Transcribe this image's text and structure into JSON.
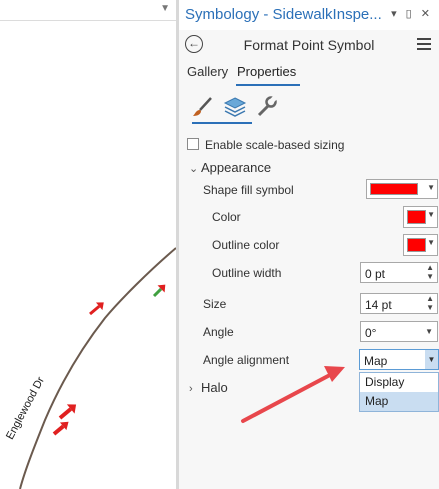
{
  "map": {
    "street_label": "Englewood Dr"
  },
  "pane": {
    "title": "Symbology - SidewalkInspe...",
    "window_controls": "▾ ▯ ✕",
    "page_title": "Format Point Symbol",
    "tabs": [
      {
        "label": "Gallery"
      },
      {
        "label": "Properties"
      }
    ],
    "icon_tabs": [
      {
        "icon": "paintbrush-icon"
      },
      {
        "icon": "layers-icon"
      },
      {
        "icon": "wrench-icon"
      }
    ],
    "scale_sizing_label": "Enable scale-based sizing",
    "appearance": {
      "section_label": "Appearance",
      "shape_fill_label": "Shape fill symbol",
      "color_label": "Color",
      "outline_color_label": "Outline color",
      "outline_width_label": "Outline width",
      "outline_width_value": "0 pt",
      "size_label": "Size",
      "size_value": "14 pt",
      "angle_label": "Angle",
      "angle_value": "0°",
      "angle_alignment_label": "Angle alignment",
      "angle_alignment_value": "Map",
      "angle_alignment_options": [
        "Display",
        "Map"
      ]
    },
    "halo_label": "Halo"
  },
  "colors": {
    "accent": "#2b70b8",
    "symbol_fill": "#ff0000",
    "annotation_arrow": "#e8474c",
    "selection": "#c9ddf1"
  }
}
